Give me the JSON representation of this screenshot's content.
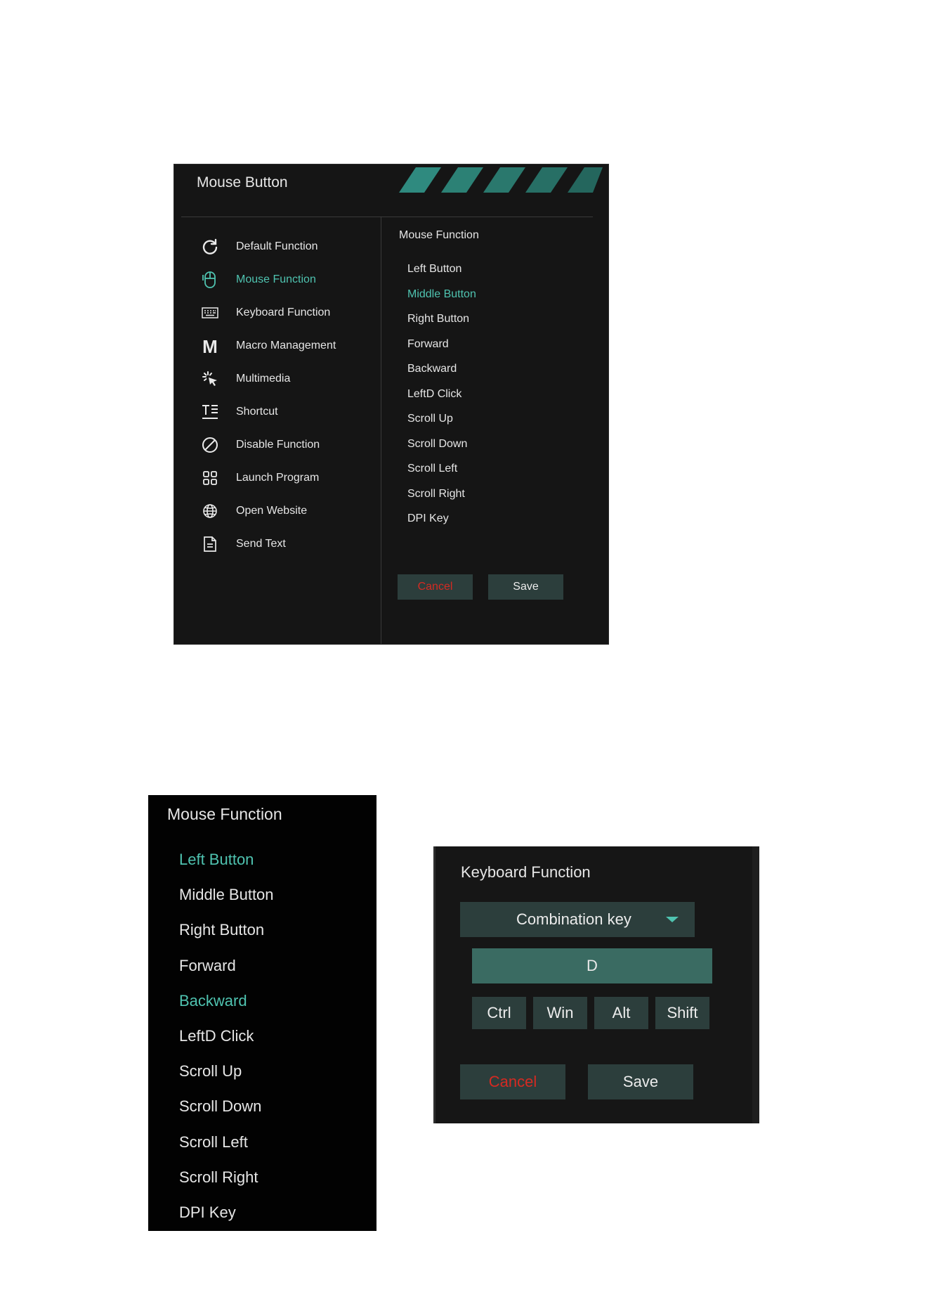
{
  "main_panel": {
    "title": "Mouse Button",
    "sidebar": {
      "items": [
        {
          "label": "Default Function",
          "icon": "refresh-icon"
        },
        {
          "label": "Mouse Function",
          "icon": "mouse-icon",
          "active": true
        },
        {
          "label": "Keyboard Function",
          "icon": "keyboard-icon"
        },
        {
          "label": "Macro Management",
          "icon": "macro-m-icon"
        },
        {
          "label": "Multimedia",
          "icon": "multimedia-click-icon"
        },
        {
          "label": "Shortcut",
          "icon": "shortcut-text-icon"
        },
        {
          "label": "Disable Function",
          "icon": "disable-icon"
        },
        {
          "label": "Launch Program",
          "icon": "grid-apps-icon"
        },
        {
          "label": "Open Website",
          "icon": "globe-icon"
        },
        {
          "label": "Send Text",
          "icon": "document-icon"
        }
      ]
    },
    "right": {
      "title": "Mouse Function",
      "items": [
        "Left Button",
        "Middle Button",
        "Right Button",
        "Forward",
        "Backward",
        "LeftD Click",
        "Scroll Up",
        "Scroll Down",
        "Scroll Left",
        "Scroll Right",
        "DPI Key"
      ],
      "active_index": 1,
      "cancel_label": "Cancel",
      "save_label": "Save"
    }
  },
  "mouse_function_panel": {
    "title": "Mouse Function",
    "items": [
      "Left Button",
      "Middle Button",
      "Right Button",
      "Forward",
      "Backward",
      "LeftD Click",
      "Scroll Up",
      "Scroll Down",
      "Scroll Left",
      "Scroll Right",
      "DPI Key"
    ],
    "active_indices": [
      0,
      4
    ]
  },
  "keyboard_panel": {
    "title": "Keyboard Function",
    "combo_label": "Combination key",
    "key_value": "D",
    "modifiers": [
      "Ctrl",
      "Win",
      "Alt",
      "Shift"
    ],
    "cancel_label": "Cancel",
    "save_label": "Save"
  },
  "colors": {
    "accent": "#4fc3b0",
    "button_bg": "#2c3e3c",
    "cancel_text": "#d52a22",
    "panel_bg": "#151515"
  }
}
